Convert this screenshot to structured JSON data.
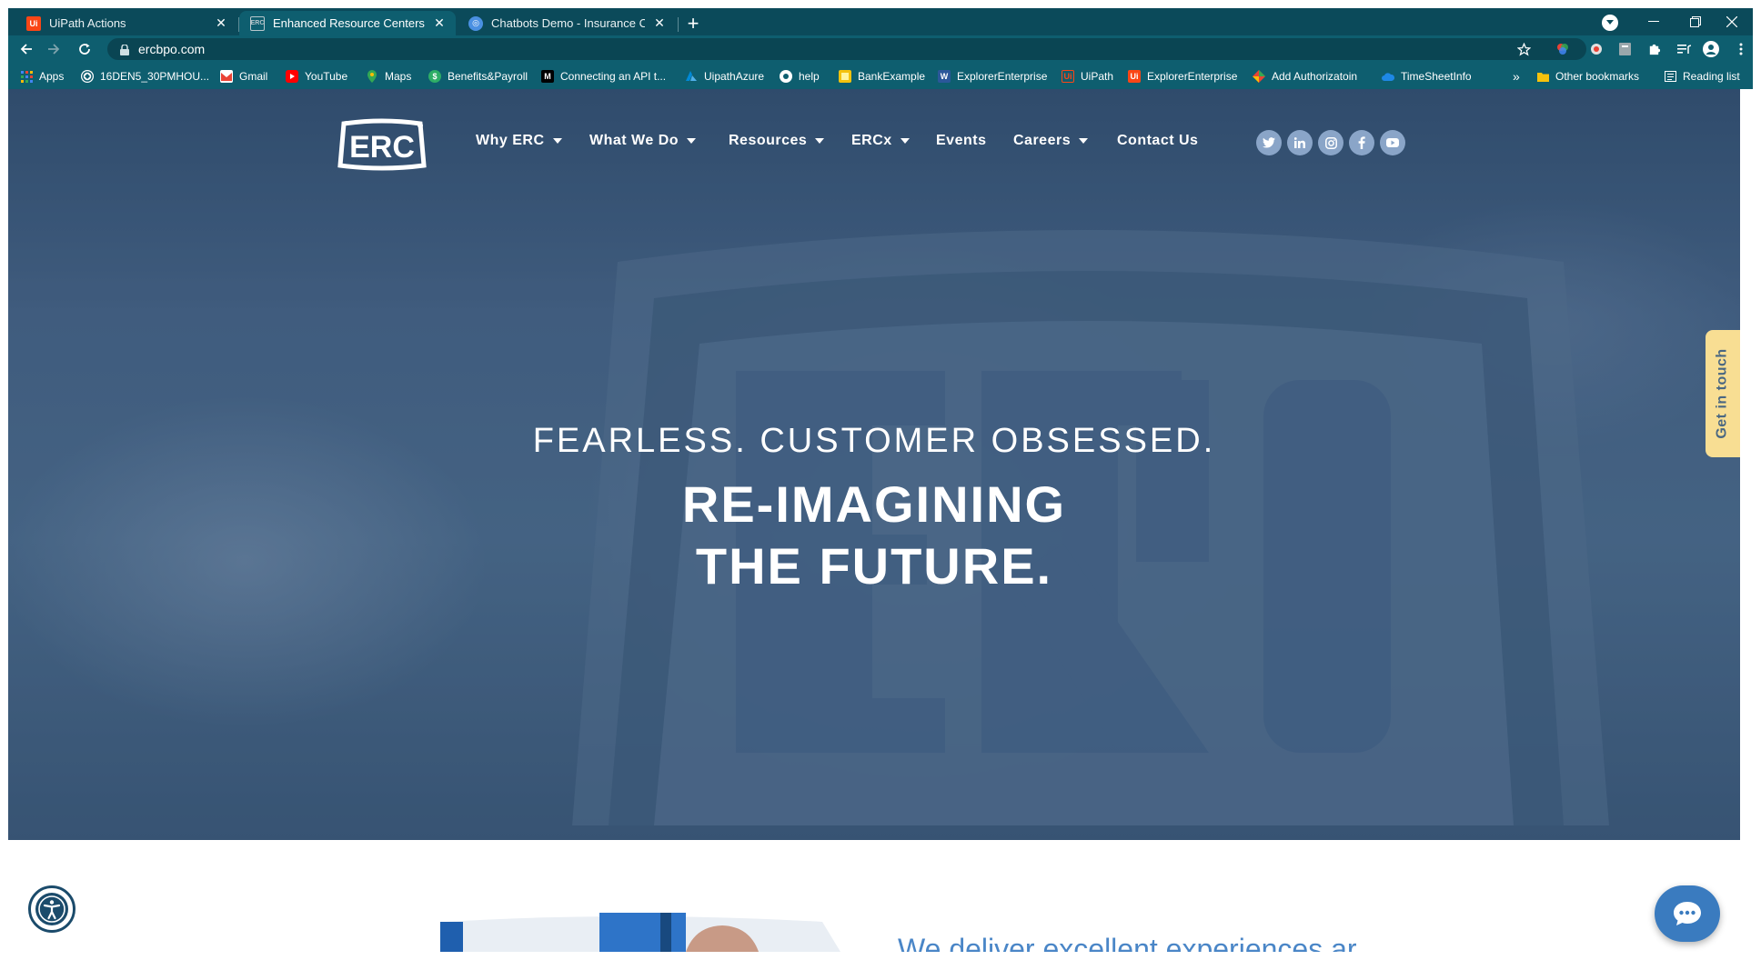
{
  "browser": {
    "tabs": [
      {
        "title": "UiPath Actions",
        "favicon": "uipath-icon",
        "active": false
      },
      {
        "title": "Enhanced Resource Centers - ER",
        "favicon": "erc-icon",
        "active": true
      },
      {
        "title": "Chatbots Demo - Insurance Claim",
        "favicon": "chatbot-icon",
        "active": false
      }
    ],
    "new_tab": "+",
    "url": "ercbpo.com",
    "bookmarks": [
      {
        "label": "Apps",
        "icon": "apps-grid-icon",
        "color": "#4285f4"
      },
      {
        "label": "16DEN5_30PMHOU...",
        "icon": "globe-icon",
        "color": "#ffffff"
      },
      {
        "label": "Gmail",
        "icon": "gmail-icon",
        "color": "#ea4335"
      },
      {
        "label": "YouTube",
        "icon": "youtube-icon",
        "color": "#ff0000"
      },
      {
        "label": "Maps",
        "icon": "maps-icon",
        "color": "#34a853"
      },
      {
        "label": "Benefits&Payroll",
        "icon": "benefits-icon",
        "color": "#2eae66"
      },
      {
        "label": "Connecting an API t...",
        "icon": "medium-icon",
        "color": "#000000"
      },
      {
        "label": "UipathAzure",
        "icon": "azure-icon",
        "color": "#0089d6"
      },
      {
        "label": "help",
        "icon": "github-icon",
        "color": "#ffffff"
      },
      {
        "label": "BankExample",
        "icon": "bank-icon",
        "color": "#f4c20d"
      },
      {
        "label": "ExplorerEnterprise",
        "icon": "word-icon",
        "color": "#2b579a"
      },
      {
        "label": "UiPath",
        "icon": "uipath-icon",
        "color": "#fa4616"
      },
      {
        "label": "ExplorerEnterprise",
        "icon": "uipath-icon",
        "color": "#fa4616"
      },
      {
        "label": "Add Authorizatoin",
        "icon": "authorization-icon",
        "color": "#e94235"
      },
      {
        "label": "TimeSheetInfo",
        "icon": "cloud-icon",
        "color": "#1e88e5"
      }
    ],
    "overflow": "»",
    "other_bookmarks": "Other bookmarks",
    "reading_list": "Reading list"
  },
  "site": {
    "logo_text": "ERC",
    "nav": [
      {
        "label": "Why ERC",
        "dropdown": true
      },
      {
        "label": "What We Do",
        "dropdown": true
      },
      {
        "label": "Resources",
        "dropdown": true
      },
      {
        "label": "ERCx",
        "dropdown": true
      },
      {
        "label": "Events",
        "dropdown": false
      },
      {
        "label": "Careers",
        "dropdown": true
      },
      {
        "label": "Contact Us",
        "dropdown": false
      }
    ],
    "social": [
      "twitter-icon",
      "linkedin-icon",
      "instagram-icon",
      "facebook-icon",
      "youtube-icon"
    ],
    "hero": {
      "tagline": "FEARLESS. CUSTOMER OBSESSED.",
      "headline_line1": "RE-IMAGINING",
      "headline_line2": "THE FUTURE."
    },
    "get_in_touch": "Get in touch",
    "below_heading": "We deliver excellent experiences ar"
  },
  "colors": {
    "chrome_tabstrip": "#0b4a5a",
    "chrome_toolbar": "#0e5e6f",
    "hero_tint": "#3f5b79",
    "get_in_touch_bg": "#f8de93",
    "chat_button": "#3a7bbf"
  }
}
